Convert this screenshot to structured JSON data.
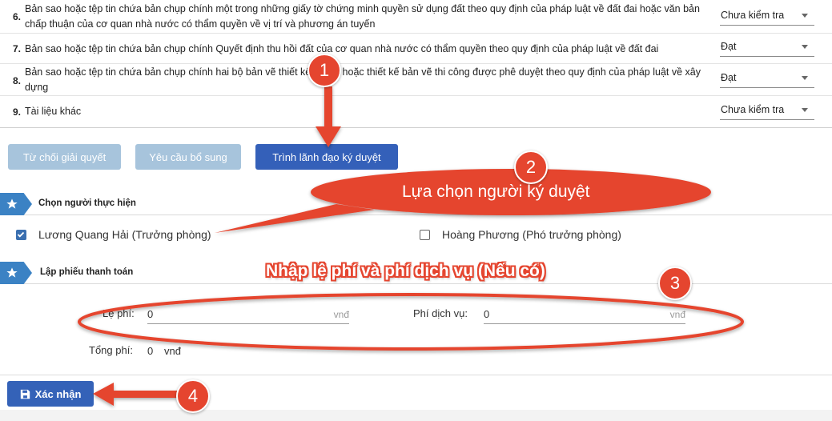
{
  "documents": [
    {
      "num": "6.",
      "text": "Bản sao hoặc tệp tin chứa bản chụp chính một trong những giấy tờ chứng minh quyền sử dụng đất theo quy định của pháp luật về đất đai hoặc văn bản chấp thuận của cơ quan nhà nước có thẩm quyền về vị trí và phương án tuyến",
      "status": "Chưa kiểm tra"
    },
    {
      "num": "7.",
      "text": "Bản sao hoặc tệp tin chứa bản chụp chính Quyết định thu hồi đất của cơ quan nhà nước có thẩm quyền theo quy định của pháp luật về đất đai",
      "status": "Đạt"
    },
    {
      "num": "8.",
      "text": "Bản sao hoặc tệp tin chứa bản chụp chính hai bộ bản vẽ thiết kế cơ sở hoặc thiết kế bản vẽ thi công được phê duyệt theo quy định của pháp luật về xây dựng",
      "status": "Đạt"
    },
    {
      "num": "9.",
      "text": "Tài liệu khác",
      "status": "Chưa kiểm tra"
    }
  ],
  "actions": {
    "reject": "Từ chối giải quyết",
    "request_more": "Yêu cầu bổ sung",
    "submit_leader": "Trình lãnh đạo ký duyệt"
  },
  "assignee_section": {
    "title": "Chọn người thực hiện",
    "people": [
      {
        "name": "Lương Quang Hải (Trưởng phòng)",
        "checked": true
      },
      {
        "name": "Hoàng Phương (Phó trưởng phòng)",
        "checked": false
      }
    ]
  },
  "payment_section": {
    "title": "Lập phiếu thanh toán",
    "fee_label": "Lệ phí:",
    "fee_value": "0",
    "service_label": "Phí dịch vụ:",
    "service_value": "0",
    "currency": "vnđ",
    "total_label": "Tổng phí:",
    "total_value": "0",
    "total_currency": "vnđ"
  },
  "confirm_button": "Xác nhận",
  "annotations": {
    "step1": "1",
    "step2": "2",
    "step3": "3",
    "step4": "4",
    "callout_signer": "Lựa chọn người ký duyệt",
    "callout_fee": "Nhập lệ phí và phí dịch vụ (Nếu có)"
  },
  "colors": {
    "primary_button": "#3460b9",
    "disabled_button": "#a7c4dc",
    "section_flag": "#3b82c4",
    "annotation_red": "#e5452f"
  }
}
